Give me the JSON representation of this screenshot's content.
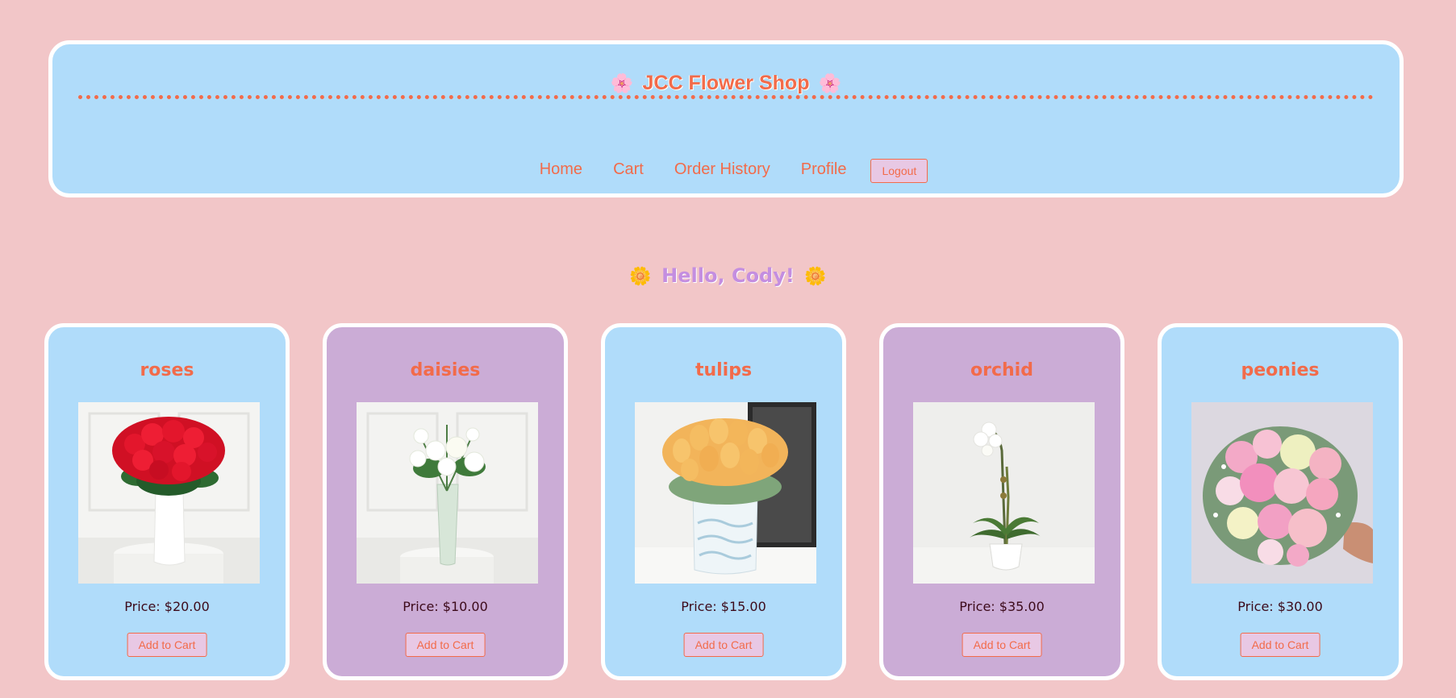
{
  "header": {
    "left_icon": "🌸",
    "title": "JCC Flower Shop",
    "right_icon": "🌸"
  },
  "nav": {
    "home": "Home",
    "cart": "Cart",
    "order_history": "Order History",
    "profile": "Profile",
    "logout": "Logout"
  },
  "greeting": {
    "left_icon": "🌼",
    "text": "Hello, Cody!",
    "right_icon": "🌼"
  },
  "products": [
    {
      "name": "roses",
      "price": "Price: $20.00",
      "button": "Add to Cart",
      "image_icon": "red-roses-in-vase"
    },
    {
      "name": "daisies",
      "price": "Price: $10.00",
      "button": "Add to Cart",
      "image_icon": "white-flowers-in-vase"
    },
    {
      "name": "tulips",
      "price": "Price: $15.00",
      "button": "Add to Cart",
      "image_icon": "yellow-tulips-in-vase"
    },
    {
      "name": "orchid",
      "price": "Price: $35.00",
      "button": "Add to Cart",
      "image_icon": "white-orchid-in-pot"
    },
    {
      "name": "peonies",
      "price": "Price: $30.00",
      "button": "Add to Cart",
      "image_icon": "pink-peony-bouquet"
    }
  ],
  "colors": {
    "page_background": "#f2c6c8",
    "card_blue": "#b0dcfa",
    "card_purple": "#cbacd6",
    "accent": "#f26b4a",
    "greeting": "#c48ee0"
  }
}
